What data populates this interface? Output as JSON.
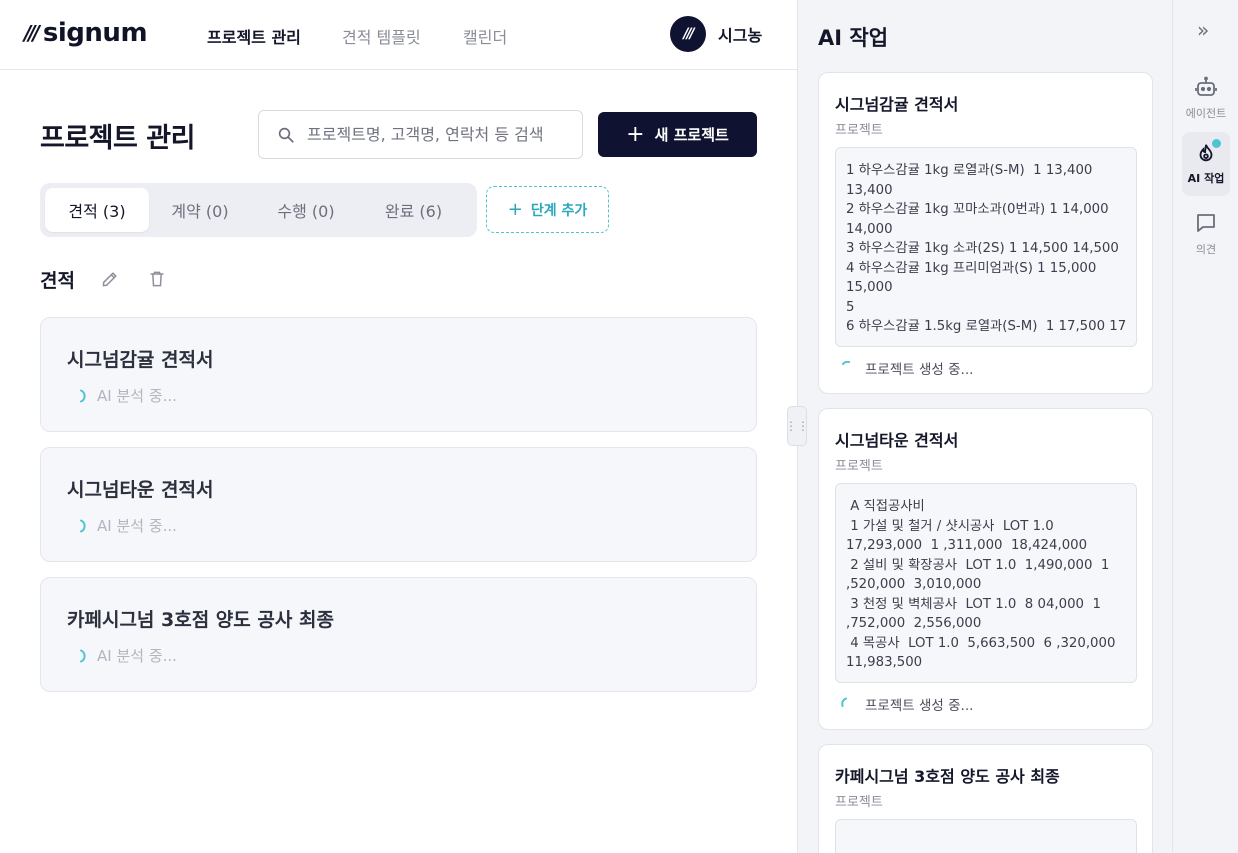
{
  "brand": {
    "logo_text": "signum"
  },
  "nav": {
    "items": [
      {
        "label": "프로젝트 관리"
      },
      {
        "label": "견적 템플릿"
      },
      {
        "label": "캘린더"
      }
    ]
  },
  "user": {
    "name": "시그농"
  },
  "page": {
    "title": "프로젝트 관리"
  },
  "search": {
    "placeholder": "프로젝트명, 고객명, 연락처 등 검색"
  },
  "new_project_button": {
    "label": "새 프로젝트"
  },
  "tabs": [
    {
      "label": "견적 (3)"
    },
    {
      "label": "계약 (0)"
    },
    {
      "label": "수행 (0)"
    },
    {
      "label": "완료 (6)"
    }
  ],
  "add_stage_button": {
    "label": "단계 추가"
  },
  "stage": {
    "title": "견적"
  },
  "project_cards": [
    {
      "title": "시그넘감귤 견적서",
      "status": "AI 분석 중..."
    },
    {
      "title": "시그넘타운 견적서",
      "status": "AI 분석 중..."
    },
    {
      "title": "카페시그넘 3호점 양도 공사 최종",
      "status": "AI 분석 중..."
    }
  ],
  "ai_panel": {
    "title": "AI 작업",
    "cards": [
      {
        "title": "시그넘감귤 견적서",
        "subtitle": "프로젝트",
        "text": "1 하우스감귤 1kg 로열과(S-M)  1 13,400\n13,400\n2 하우스감귤 1kg 꼬마소과(0번과) 1 14,000\n14,000\n3 하우스감귤 1kg 소과(2S) 1 14,500 14,500\n4 하우스감귤 1kg 프리미엄과(S) 1 15,000\n15,000\n5\n6 하우스감귤 1.5kg 로열과(S-M)  1 17,500 17",
        "progress": "프로젝트 생성 중..."
      },
      {
        "title": "시그넘타운 견적서",
        "subtitle": "프로젝트",
        "text": " A 직접공사비\n 1 가설 및 철거 / 샷시공사  LOT 1.0\n17,293,000  1 ,311,000  18,424,000\n 2 설비 및 확장공사  LOT 1.0  1,490,000  1\n,520,000  3,010,000\n 3 천정 및 벽체공사  LOT 1.0  8 04,000  1\n,752,000  2,556,000\n 4 목공사  LOT 1.0  5,663,500  6 ,320,000\n11,983,500",
        "progress": "프로젝트 생성 중..."
      },
      {
        "title": "카페시그넘 3호점 양도 공사 최종",
        "subtitle": "프로젝트"
      }
    ]
  },
  "rail": {
    "items": [
      {
        "label": "에이전트"
      },
      {
        "label": "AI 작업"
      },
      {
        "label": "의견"
      }
    ]
  },
  "colors": {
    "primary": "#0f1230",
    "accent": "#4fc3d4",
    "panel_bg": "#f3f4f7"
  }
}
